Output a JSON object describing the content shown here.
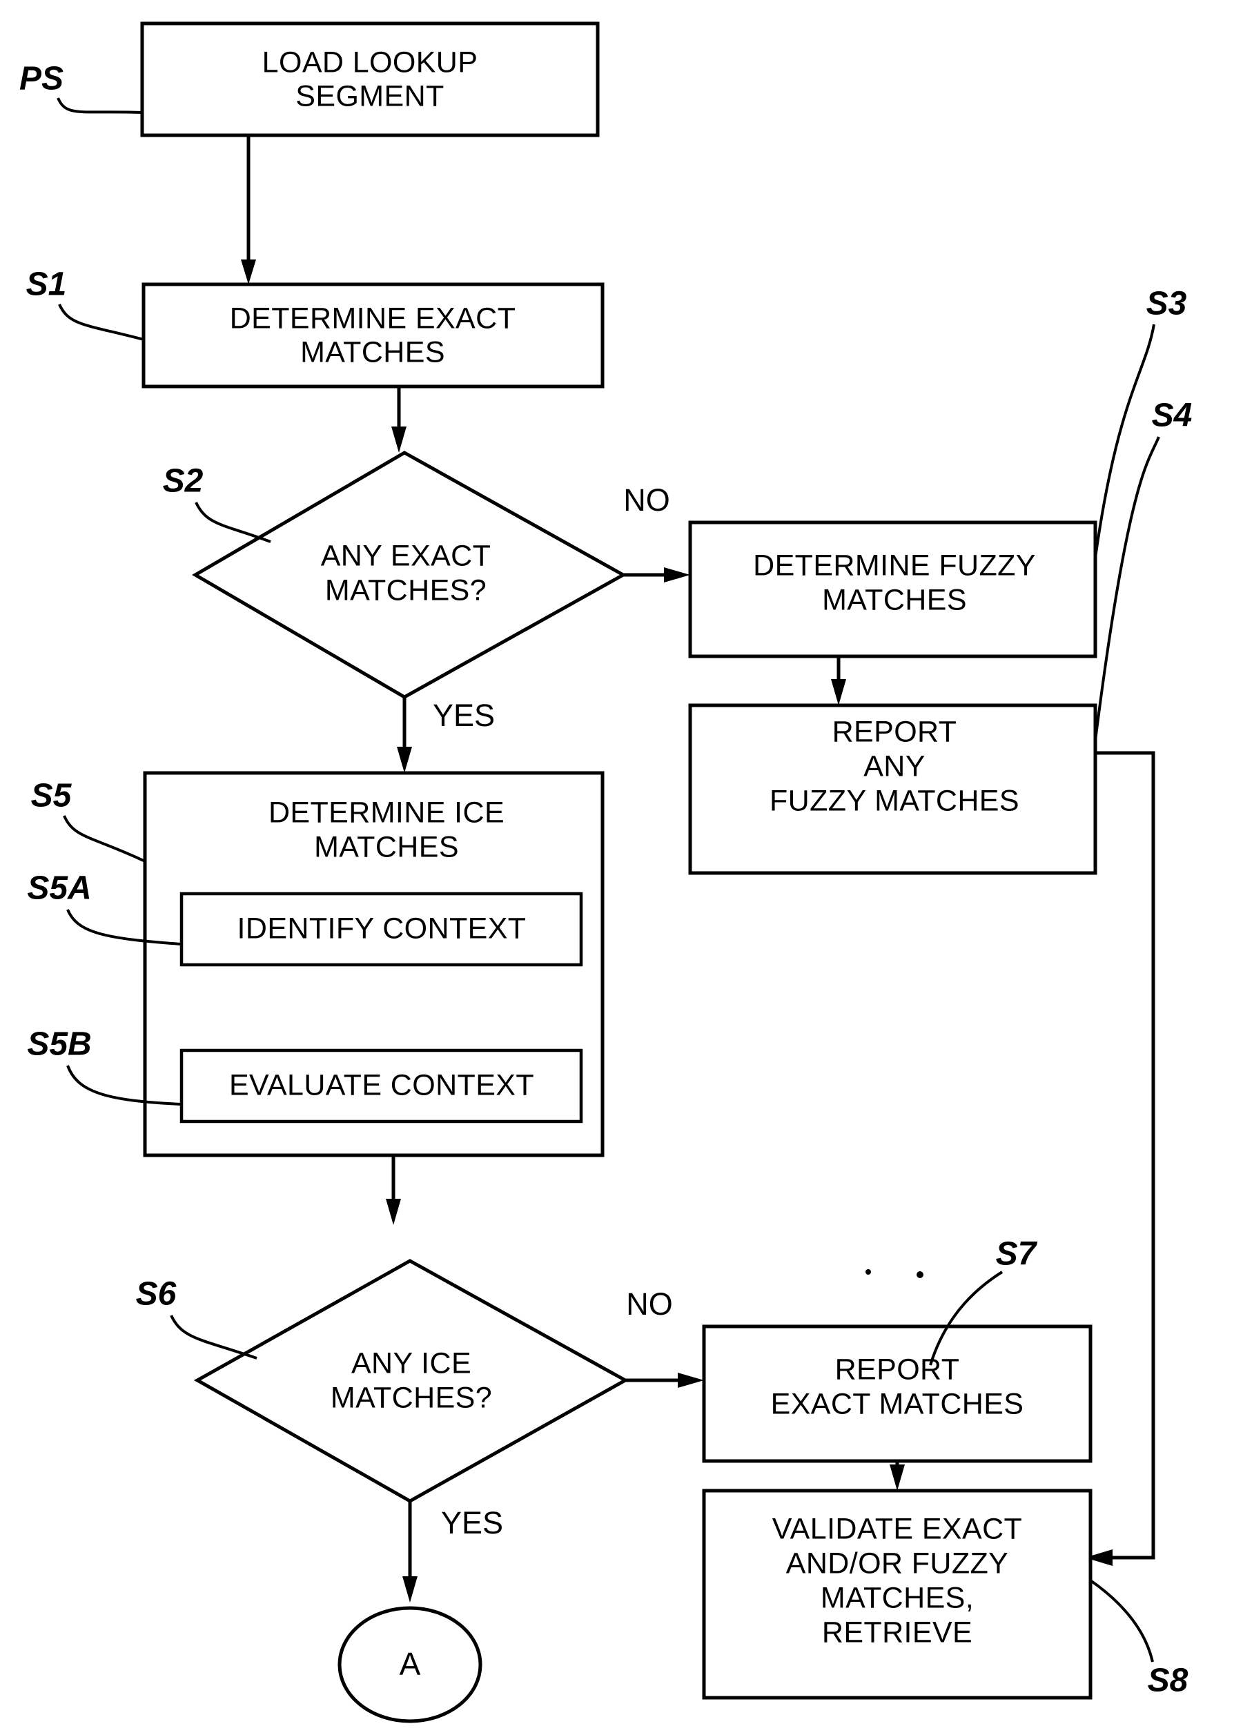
{
  "figure": {
    "type": "patent-flowchart",
    "background_color": "#ffffff",
    "line_color": "#000000"
  },
  "nodes": {
    "ps": {
      "ref": "PS",
      "shape": "rectangle",
      "lines": [
        "LOAD LOOKUP",
        "SEGMENT"
      ]
    },
    "s1": {
      "ref": "S1",
      "shape": "rectangle",
      "lines": [
        "DETERMINE EXACT",
        "MATCHES"
      ]
    },
    "s2": {
      "ref": "S2",
      "shape": "diamond",
      "lines": [
        "ANY EXACT",
        "MATCHES?"
      ]
    },
    "s3": {
      "ref": "S3",
      "shape": "rectangle",
      "lines": [
        "DETERMINE FUZZY",
        "MATCHES"
      ]
    },
    "s4": {
      "ref": "S4",
      "shape": "rectangle",
      "lines": [
        "REPORT",
        "ANY",
        "FUZZY MATCHES"
      ]
    },
    "s5": {
      "ref": "S5",
      "shape": "rectangle",
      "lines": [
        "DETERMINE ICE",
        "MATCHES"
      ]
    },
    "s5a": {
      "ref": "S5A",
      "shape": "rectangle",
      "lines": [
        "IDENTIFY CONTEXT"
      ]
    },
    "s5b": {
      "ref": "S5B",
      "shape": "rectangle",
      "lines": [
        "EVALUATE CONTEXT"
      ]
    },
    "s6": {
      "ref": "S6",
      "shape": "diamond",
      "lines": [
        "ANY ICE",
        "MATCHES?"
      ]
    },
    "s7": {
      "ref": "S7",
      "shape": "rectangle",
      "lines": [
        "REPORT",
        "EXACT MATCHES"
      ]
    },
    "s8": {
      "ref": "S8",
      "shape": "rectangle",
      "lines": [
        "VALIDATE EXACT",
        "AND/OR FUZZY",
        "MATCHES,",
        "RETRIEVE"
      ]
    },
    "connector_a": {
      "shape": "ellipse",
      "label": "A"
    }
  },
  "branch_labels": {
    "s2_no": "NO",
    "s2_yes": "YES",
    "s6_no": "NO",
    "s6_yes": "YES"
  },
  "edges": [
    {
      "from": "ps",
      "to": "s1",
      "label": ""
    },
    {
      "from": "s1",
      "to": "s2",
      "label": ""
    },
    {
      "from": "s2",
      "to": "s3",
      "label": "NO"
    },
    {
      "from": "s2",
      "to": "s5",
      "label": "YES"
    },
    {
      "from": "s3",
      "to": "s4",
      "label": ""
    },
    {
      "from": "s4",
      "to": "s8",
      "label": ""
    },
    {
      "from": "s5",
      "to": "s6",
      "label": ""
    },
    {
      "from": "s6",
      "to": "s7",
      "label": "NO"
    },
    {
      "from": "s6",
      "to": "connector_a",
      "label": "YES"
    },
    {
      "from": "s7",
      "to": "s8",
      "label": ""
    }
  ]
}
